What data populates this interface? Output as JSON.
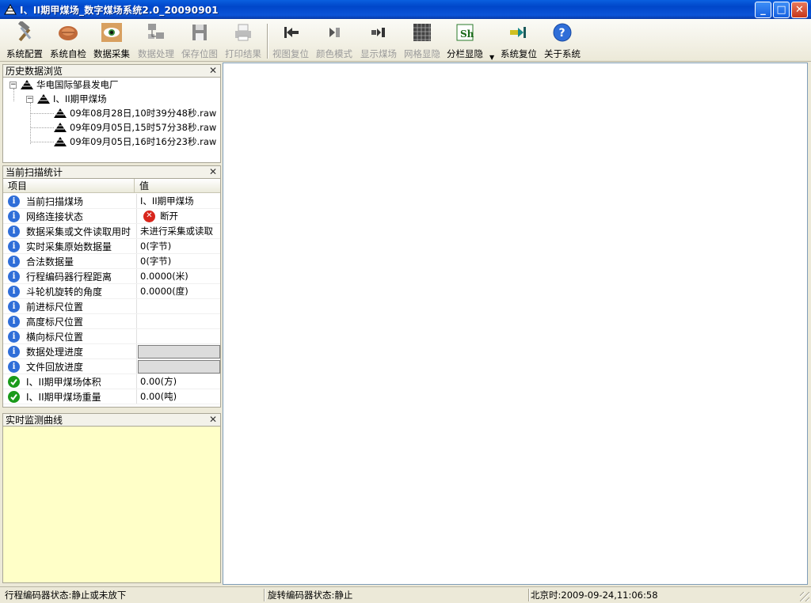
{
  "window": {
    "title": "I、II期甲煤场_数字煤场系统2.0_20090901",
    "icon": "coal-pile-icon",
    "controls": [
      "minimize",
      "maximize",
      "close"
    ]
  },
  "toolbar": {
    "items": [
      {
        "label": "系统配置",
        "icon": "hammer-wrench-icon",
        "enabled": true
      },
      {
        "label": "系统自检",
        "icon": "hand-check-icon",
        "enabled": true
      },
      {
        "label": "数据采集",
        "icon": "eye-icon",
        "enabled": true
      },
      {
        "label": "数据处理",
        "icon": "network-computers-icon",
        "enabled": false
      },
      {
        "label": "保存位图",
        "icon": "floppy-disk-icon",
        "enabled": false
      },
      {
        "label": "打印结果",
        "icon": "printer-icon",
        "enabled": false
      },
      {
        "label": "视图复位",
        "icon": "arrow-left-bar-icon",
        "enabled": false
      },
      {
        "label": "颜色模式",
        "icon": "color-mode-icon",
        "enabled": false
      },
      {
        "label": "显示煤场",
        "icon": "display-yard-icon",
        "enabled": false
      },
      {
        "label": "网格显隐",
        "icon": "grid-icon",
        "enabled": false
      },
      {
        "label": "分栏显隐",
        "icon": "split-column-icon",
        "enabled": true
      },
      {
        "label": "系统复位",
        "icon": "arrow-right-bar-icon",
        "enabled": true
      },
      {
        "label": "关于系统",
        "icon": "help-circle-icon",
        "enabled": true
      }
    ]
  },
  "history_panel": {
    "title": "历史数据浏览",
    "tree": {
      "root": "华电国际邹县发电厂",
      "child": "I、II期甲煤场",
      "files": [
        "09年08月28日,10时39分48秒.raw",
        "09年09月05日,15时57分38秒.raw",
        "09年09月05日,16时16分23秒.raw"
      ]
    }
  },
  "stats_panel": {
    "title": "当前扫描统计",
    "columns": [
      "项目",
      "值"
    ],
    "rows": [
      {
        "name": "当前扫描煤场",
        "value": "I、II期甲煤场",
        "icon": "info-icon"
      },
      {
        "name": "网络连接状态",
        "value": "断开",
        "icon": "info-icon",
        "value_icon": "error-x-icon"
      },
      {
        "name": "数据采集或文件读取用时",
        "value": "未进行采集或读取",
        "icon": "info-icon"
      },
      {
        "name": "实时采集原始数据量",
        "value": "0(字节)",
        "icon": "info-icon"
      },
      {
        "name": "合法数据量",
        "value": "0(字节)",
        "icon": "info-icon"
      },
      {
        "name": "行程编码器行程距离",
        "value": "0.0000(米)",
        "icon": "info-icon"
      },
      {
        "name": "斗轮机旋转的角度",
        "value": "0.0000(度)",
        "icon": "info-icon"
      },
      {
        "name": "前进标尺位置",
        "value": "",
        "icon": "info-icon"
      },
      {
        "name": "高度标尺位置",
        "value": "",
        "icon": "info-icon"
      },
      {
        "name": "横向标尺位置",
        "value": "",
        "icon": "info-icon"
      },
      {
        "name": "数据处理进度",
        "value": "",
        "icon": "info-icon",
        "progress": 0
      },
      {
        "name": "文件回放进度",
        "value": "",
        "icon": "info-icon",
        "progress": 0
      },
      {
        "name": "I、II期甲煤场体积",
        "value": "0.00(方)",
        "icon": "check-icon"
      },
      {
        "name": "I、II期甲煤场重量",
        "value": "0.00(吨)",
        "icon": "check-icon"
      }
    ]
  },
  "curve_panel": {
    "title": "实时监测曲线"
  },
  "statusbar": {
    "encoder_status": "行程编码器状态:静止或未放下",
    "rotation_status": "旋转编码器状态:静止",
    "beijing_time": "北京时:2009-09-24,11:06:58"
  },
  "colors": {
    "titlebar": "#0a54d8",
    "curve_background": "#ffffc8",
    "info_blue": "#2f6ed8",
    "check_green": "#1a9a1a",
    "error_red": "#d8261c"
  }
}
